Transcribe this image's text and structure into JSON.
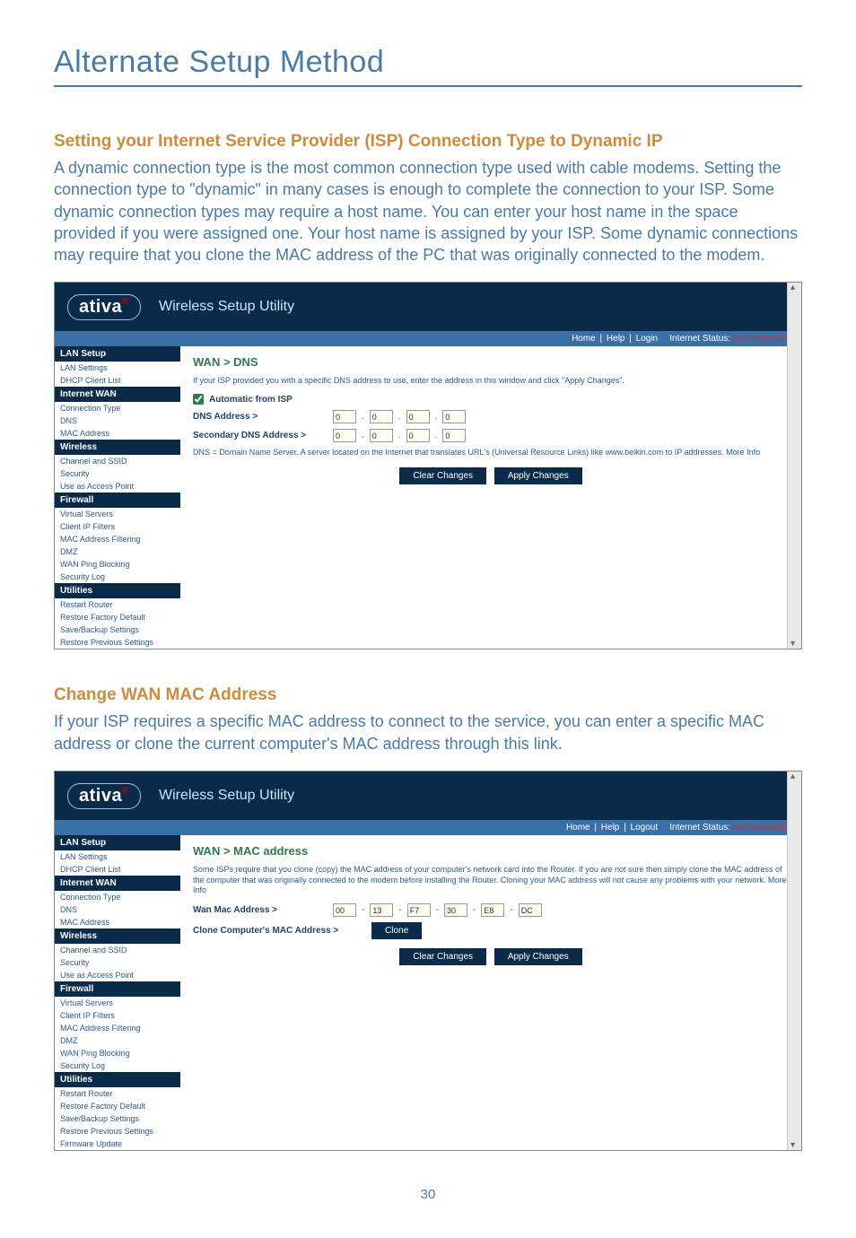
{
  "page": {
    "title": "Alternate Setup Method",
    "number": "30"
  },
  "section1": {
    "heading": "Setting your Internet Service Provider (ISP) Connection Type to Dynamic IP",
    "body": "A dynamic connection type is the most common connection type used with cable modems. Setting the connection type to \"dynamic\" in many cases is enough to complete the connection to your ISP. Some dynamic connection types may require a host name. You can enter your host name in the space provided if you were assigned one. Your host name is assigned by your ISP. Some dynamic connections may require that you clone the MAC address of the PC that was originally connected to the modem."
  },
  "section2": {
    "heading": "Change WAN MAC Address",
    "body": "If your ISP requires a specific MAC address to connect to the service, you can enter a specific MAC address or clone the current computer's MAC address through this link."
  },
  "utility": {
    "logo": "ativa",
    "title": "Wireless Setup Utility",
    "strip_home": "Home",
    "strip_help": "Help",
    "strip_login": "Login",
    "strip_logout": "Logout",
    "strip_status_label": "Internet Status:",
    "strip_status_value": "No Connection"
  },
  "nav": {
    "lan_setup": "LAN Setup",
    "lan_settings": "LAN Settings",
    "dhcp_client_list": "DHCP Client List",
    "internet_wan": "Internet WAN",
    "connection_type": "Connection Type",
    "dns": "DNS",
    "mac_address": "MAC Address",
    "wireless": "Wireless",
    "channel_ssid": "Channel and SSID",
    "security": "Security",
    "use_as_ap": "Use as Access Point",
    "firewall": "Firewall",
    "virtual_servers": "Virtual Servers",
    "client_ip_filters": "Client IP Filters",
    "mac_filtering": "MAC Address Filtering",
    "dmz": "DMZ",
    "wan_ping": "WAN Ping Blocking",
    "security_log": "Security Log",
    "utilities": "Utilities",
    "restart": "Restart Router",
    "restore_default": "Restore Factory Default",
    "save_backup": "Save/Backup Settings",
    "restore_prev": "Restore Previous Settings",
    "firmware": "Firmware Update"
  },
  "shot1": {
    "crumb": "WAN > DNS",
    "help": "If your ISP provided you with a specific DNS address to use, enter the address in this window and click \"Apply Changes\".",
    "auto_label": "Automatic from ISP",
    "dns_addr_label": "DNS Address >",
    "secondary_label": "Secondary DNS Address >",
    "oct": [
      "0",
      "0",
      "0",
      "0"
    ],
    "footnote_a": "DNS = Domain Name Server. A server located on the Internet that translates URL's (Universal Resource Links) like www.belkin.com to IP addresses.",
    "more_info": "More Info"
  },
  "shot2": {
    "crumb": "WAN > MAC address",
    "help_a": "Some ISPs require that you clone (copy) the MAC address of your computer's network card into the Router. If you are not sure then simply clone the MAC address of the computer that was originally connected to the modem before installing the Router. Cloning your MAC address will not cause any problems with your network.",
    "more_info": "More Info",
    "wan_mac_label": "Wan Mac Address >",
    "mac": [
      "00",
      "13",
      "F7",
      "30",
      "E8",
      "DC"
    ],
    "clone_label": "Clone Computer's MAC Address >",
    "clone_btn": "Clone"
  },
  "buttons": {
    "clear": "Clear Changes",
    "apply": "Apply Changes"
  }
}
